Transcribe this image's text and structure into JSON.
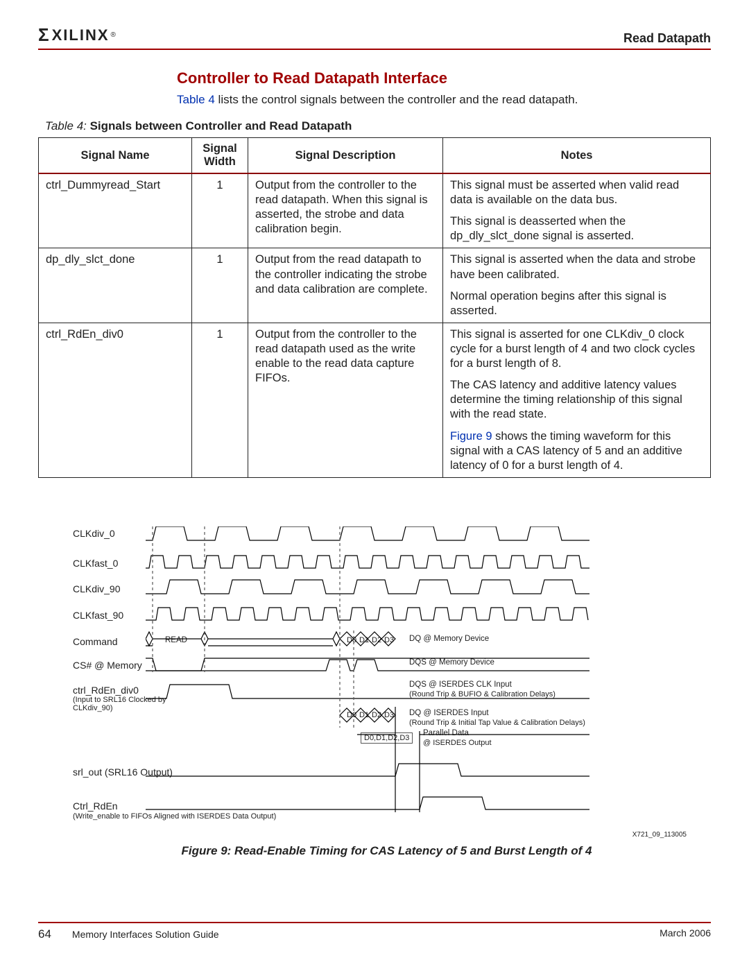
{
  "header": {
    "logo_text": "XILINX",
    "right": "Read Datapath"
  },
  "section_title": "Controller to Read Datapath Interface",
  "intro": {
    "pre": "Table 4",
    "rest": " lists the control signals between the controller and the read datapath."
  },
  "table": {
    "caption_prefix": "Table  4:",
    "caption_rest": "  Signals between Controller and Read Datapath",
    "headers": {
      "name": "Signal Name",
      "width": "Signal Width",
      "desc": "Signal Description",
      "notes": "Notes"
    }
  },
  "rows": [
    {
      "name": "ctrl_Dummyread_Start",
      "width": "1",
      "desc": "Output from the controller to the read datapath. When this signal is asserted, the strobe and data calibration begin.",
      "notes1": "This signal must be asserted when valid read data is available on the data bus.",
      "notes2": "This signal is deasserted when the dp_dly_slct_done signal is asserted."
    },
    {
      "name": "dp_dly_slct_done",
      "width": "1",
      "desc": "Output from the read datapath to the controller indicating the strobe and data calibration are complete.",
      "notes1": "This signal is asserted when the data and strobe have been calibrated.",
      "notes2": "Normal operation begins after this signal is asserted."
    },
    {
      "name": "ctrl_RdEn_div0",
      "width": "1",
      "desc": "Output from the controller to the read datapath used as the write enable to the read data capture FIFOs.",
      "notes1": "This signal is asserted for one CLKdiv_0 clock cycle for a burst length of 4 and two clock cycles for a burst length of 8.",
      "notes2": "The CAS latency and additive latency values determine the timing relationship of this signal with the read state.",
      "notes3_link": "Figure 9",
      "notes3_rest": " shows the timing waveform for this signal with a CAS latency of 5 and an additive latency of 0 for a burst length of 4."
    }
  ],
  "figure": {
    "labels": {
      "clkdiv0": "CLKdiv_0",
      "clkfast0": "CLKfast_0",
      "clkdiv90": "CLKdiv_90",
      "clkfast90": "CLKfast_90",
      "command": "Command",
      "read": "READ",
      "csmem": "CS# @ Memory",
      "dqmem": "DQ @ Memory Device",
      "dqsmem": "DQS @ Memory Device",
      "ctrlrden": "ctrl_RdEn_div0",
      "ctrlrden_sub": "(Input to SRL16 Clocked by CLKdiv_90)",
      "dqsiserdes": "DQS @ ISERDES CLK Input",
      "dqsiserdes_sub": "(Round Trip & BUFIO & Calibration Delays)",
      "dqiserdes": "DQ @ ISERDES Input",
      "dqiserdes_sub": "(Round Trip & Initial Tap Value & Calibration Delays)",
      "parallel": "Parallel Data",
      "parallel_sub": "@ ISERDES Output",
      "d_items": "D0,D1,D2,D3",
      "d0": "D0",
      "d1": "D1",
      "d2": "D2",
      "d3": "D3",
      "srl": "srl_out (SRL16 Output)",
      "ctrl_rden2": "Ctrl_RdEn",
      "ctrl_rden2_sub": "(Write_enable to FIFOs Aligned with ISERDES Data Output)",
      "figid": "X721_09_113005"
    },
    "caption": "Figure 9:  Read-Enable Timing for CAS Latency of 5 and Burst Length of 4"
  },
  "footer": {
    "page": "64",
    "title": "Memory Interfaces Solution Guide",
    "date": "March 2006"
  }
}
